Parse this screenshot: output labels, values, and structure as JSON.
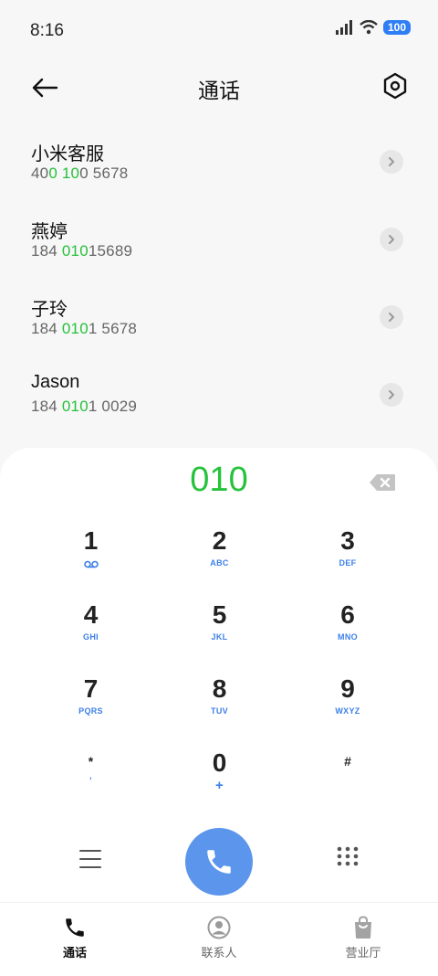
{
  "status_bar": {
    "time": "8:16",
    "battery": "100"
  },
  "header": {
    "title": "通话"
  },
  "contacts": [
    {
      "name": "小米客服",
      "number_parts": [
        "40",
        "0",
        " ",
        "10",
        "0 5678"
      ]
    },
    {
      "name": "燕婷",
      "number_parts": [
        "184 ",
        "010",
        "15689",
        "",
        ""
      ]
    },
    {
      "name": "子玲",
      "number_parts": [
        "184 ",
        "010",
        "1 5678",
        "",
        ""
      ]
    },
    {
      "name": "Jason",
      "number_parts": [
        "184 ",
        "010",
        "1 0029",
        "",
        ""
      ]
    }
  ],
  "dialpad": {
    "input": "010",
    "keys": [
      {
        "digit": "1",
        "letters": ""
      },
      {
        "digit": "2",
        "letters": "ABC"
      },
      {
        "digit": "3",
        "letters": "DEF"
      },
      {
        "digit": "4",
        "letters": "GHI"
      },
      {
        "digit": "5",
        "letters": "JKL"
      },
      {
        "digit": "6",
        "letters": "MNO"
      },
      {
        "digit": "7",
        "letters": "PQRS"
      },
      {
        "digit": "8",
        "letters": "TUV"
      },
      {
        "digit": "9",
        "letters": "WXYZ"
      },
      {
        "digit": "*",
        "letters": ","
      },
      {
        "digit": "0",
        "letters": "+"
      },
      {
        "digit": "#",
        "letters": ""
      }
    ]
  },
  "tabs": [
    {
      "label": "通话",
      "icon": "phone-icon",
      "active": true
    },
    {
      "label": "联系人",
      "icon": "contact-icon",
      "active": false
    },
    {
      "label": "营业厅",
      "icon": "bag-icon",
      "active": false
    }
  ],
  "colors": {
    "highlight": "#25c13a",
    "accent": "#5b95ec",
    "letters": "#3c7fe8"
  }
}
